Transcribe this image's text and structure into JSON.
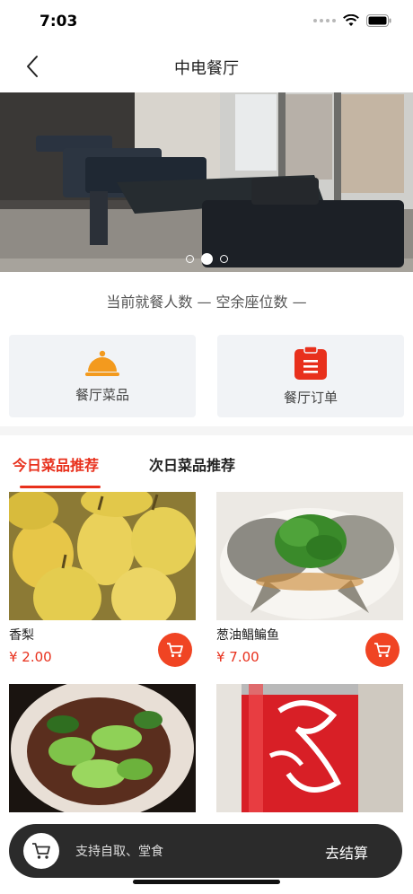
{
  "status_bar": {
    "time": "7:03",
    "icons": [
      "signal-icon",
      "wifi-icon",
      "battery-icon"
    ]
  },
  "nav": {
    "title": "中电餐厅",
    "back_icon": "chevron-left-icon"
  },
  "banner": {
    "slide_count": 3,
    "active_index": 1
  },
  "stats": {
    "text": "当前就餐人数 —   空余座位数 —"
  },
  "quick_actions": [
    {
      "label": "餐厅菜品",
      "icon": "cloche-icon",
      "color": "#f39a1e"
    },
    {
      "label": "餐厅订单",
      "icon": "clipboard-icon",
      "color": "#e8301c"
    }
  ],
  "tabs": [
    {
      "label": "今日菜品推荐",
      "active": true
    },
    {
      "label": "次日菜品推荐",
      "active": false
    }
  ],
  "dishes": [
    {
      "name": "香梨",
      "price": "¥ 2.00",
      "image": "pears-photo"
    },
    {
      "name": "葱油鲳鳊鱼",
      "price": "¥ 7.00",
      "image": "fish-photo"
    },
    {
      "name": "",
      "price": "",
      "image": "bokchoy-photo"
    },
    {
      "name": "",
      "price": "",
      "image": "cola-can-photo"
    }
  ],
  "bottom_bar": {
    "pickup_text": "支持自取、堂食",
    "checkout_label": "去结算"
  },
  "colors": {
    "accent": "#e8301c",
    "orange": "#f39a1e",
    "dark_bar": "#2b2b2b"
  }
}
